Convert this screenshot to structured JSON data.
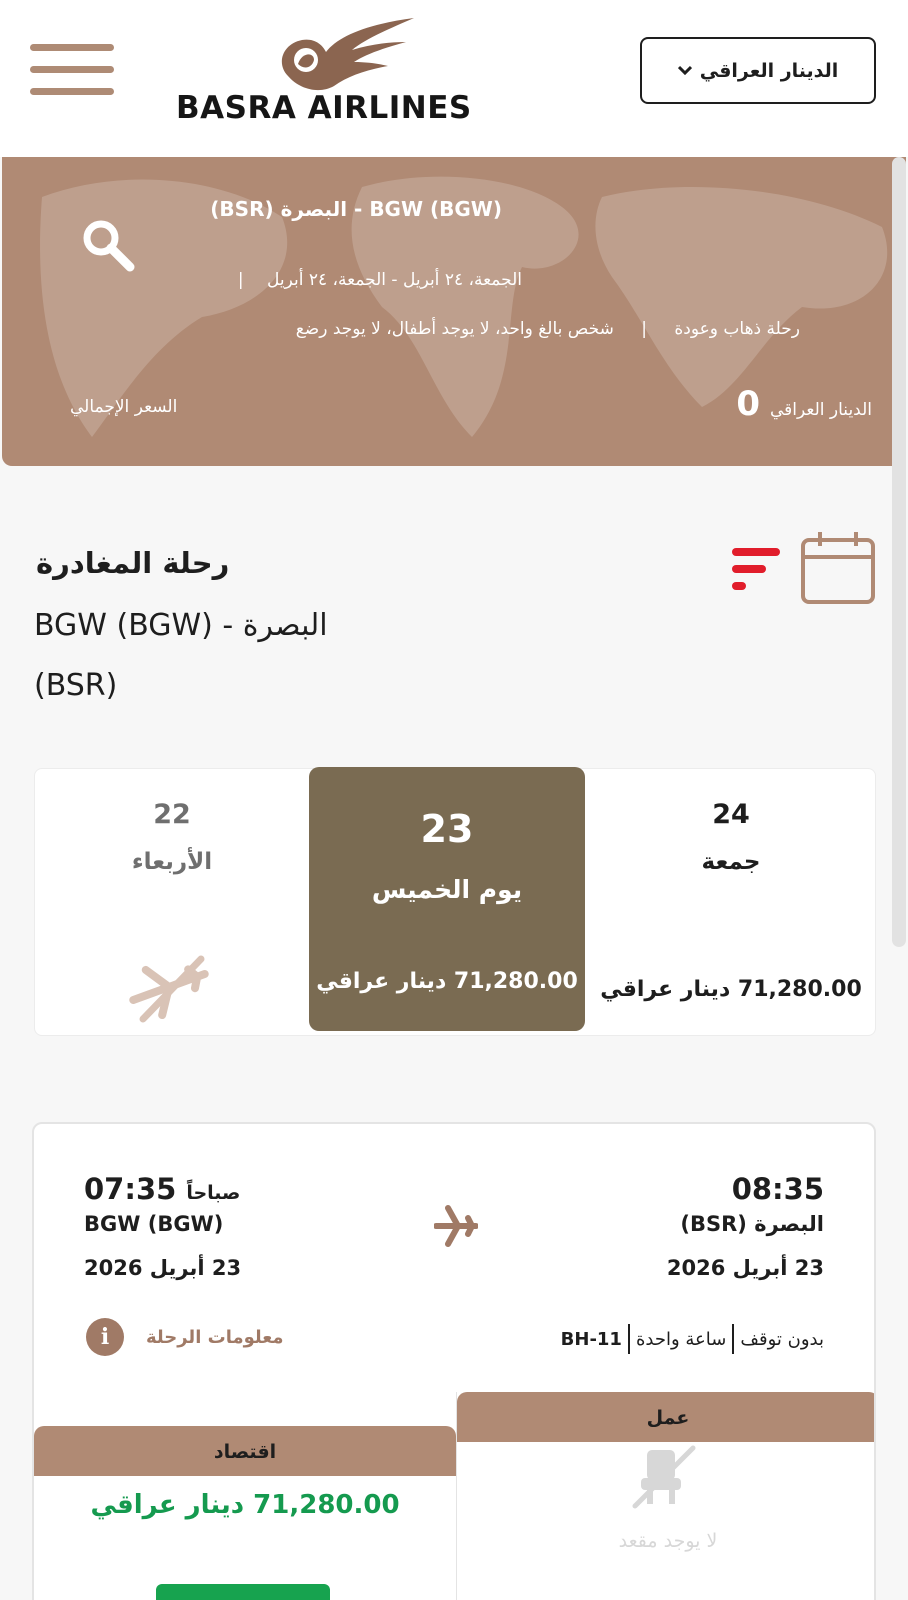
{
  "header": {
    "brand": "BASRA AIRLINES",
    "currency_label": "الدينار العراقي"
  },
  "search_summary": {
    "route": "BGW (BGW) - البصرة (BSR)",
    "dates": "الجمعة، ٢٤ أبريل - الجمعة، ٢٤ أبريل",
    "trip_type": "رحلة ذهاب وعودة",
    "passengers": "شخص بالغ واحد، لا يوجد أطفال، لا يوجد رضع",
    "currency": "الدينار العراقي",
    "total_amount": "0",
    "total_label": "السعر الإجمالي"
  },
  "departure": {
    "title": "رحلة المغادرة",
    "route_line1": "BGW (BGW) - البصرة",
    "route_line2": "(BSR)"
  },
  "date_options": [
    {
      "num": "22",
      "day": "الأربعاء",
      "price": ""
    },
    {
      "num": "23",
      "day": "يوم الخميس",
      "price": "71,280.00 دينار عراقي"
    },
    {
      "num": "24",
      "day": "جمعة",
      "price": "71,280.00 دينار عراقي"
    }
  ],
  "flight": {
    "dep_time": "08:35",
    "dep_city": "البصرة (BSR)",
    "dep_date": "23 أبريل 2026",
    "arr_ampm": "صباحاً",
    "arr_time": "07:35",
    "arr_city": "BGW (BGW)",
    "arr_date": "23 أبريل 2026",
    "stops": "بدون توقف",
    "duration": "ساعة واحدة",
    "code": "BH-11",
    "info_label": "معلومات الرحلة",
    "info_icon": "i",
    "business": {
      "label": "عمل",
      "status": "لا يوجد مقعد"
    },
    "economy": {
      "label": "اقتصاد",
      "price": "71,280.00 دينار عراقي"
    }
  },
  "colors": {
    "brand": "#b08a74",
    "selected_date": "#7a6b52",
    "filter_accent": "#e11d2b",
    "economy_price": "#159a4f"
  },
  "icons": [
    "menu-icon",
    "chevron-down-icon",
    "search-icon",
    "filter-icon",
    "calendar-icon",
    "no-flights-plane-icon",
    "plane-icon",
    "info-icon",
    "no-seat-icon"
  ]
}
